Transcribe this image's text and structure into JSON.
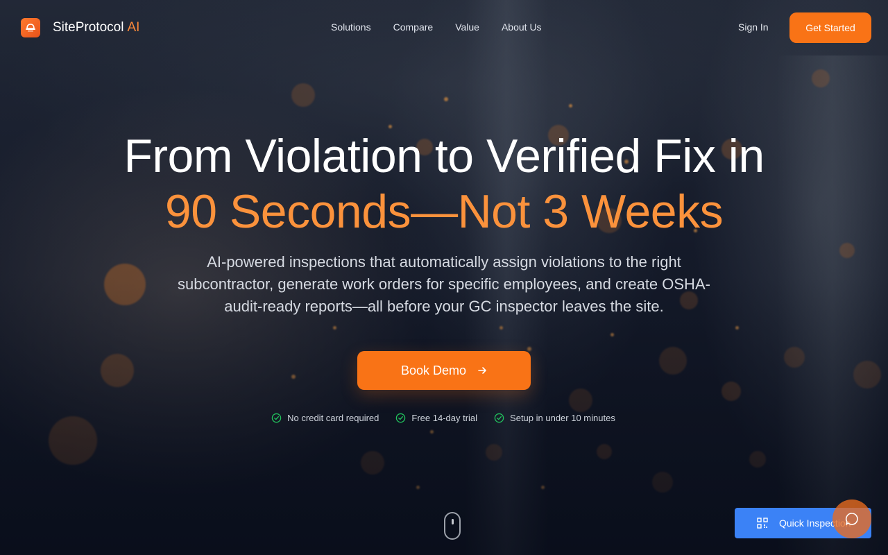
{
  "brand": {
    "name": "SiteProtocol",
    "suffix": "AI",
    "accent": "#f97316"
  },
  "nav": {
    "items": [
      {
        "label": "Solutions"
      },
      {
        "label": "Compare"
      },
      {
        "label": "Value"
      },
      {
        "label": "About Us"
      }
    ],
    "sign_in": "Sign In",
    "get_started": "Get Started"
  },
  "hero": {
    "title_line1": "From Violation to Verified Fix in",
    "title_line2": "90 Seconds—Not 3 Weeks",
    "subtitle": "AI-powered inspections that automatically assign violations to the right subcontractor, generate work orders for specific employees, and create OSHA-audit-ready reports—all before your GC inspector leaves the site.",
    "cta_label": "Book Demo",
    "perks": [
      {
        "label": "No credit card required",
        "icon": "check-circle-icon"
      },
      {
        "label": "Free 14-day trial",
        "icon": "check-circle-icon"
      },
      {
        "label": "Setup in under 10 minutes",
        "icon": "check-circle-icon"
      }
    ]
  },
  "floating": {
    "quick_inspection": "Quick Inspection",
    "quick_icon": "qr-code-icon",
    "chat_icon": "chat-bubble-icon",
    "quick_color": "#3b82f6"
  },
  "scroll_indicator_icon": "mouse-icon"
}
